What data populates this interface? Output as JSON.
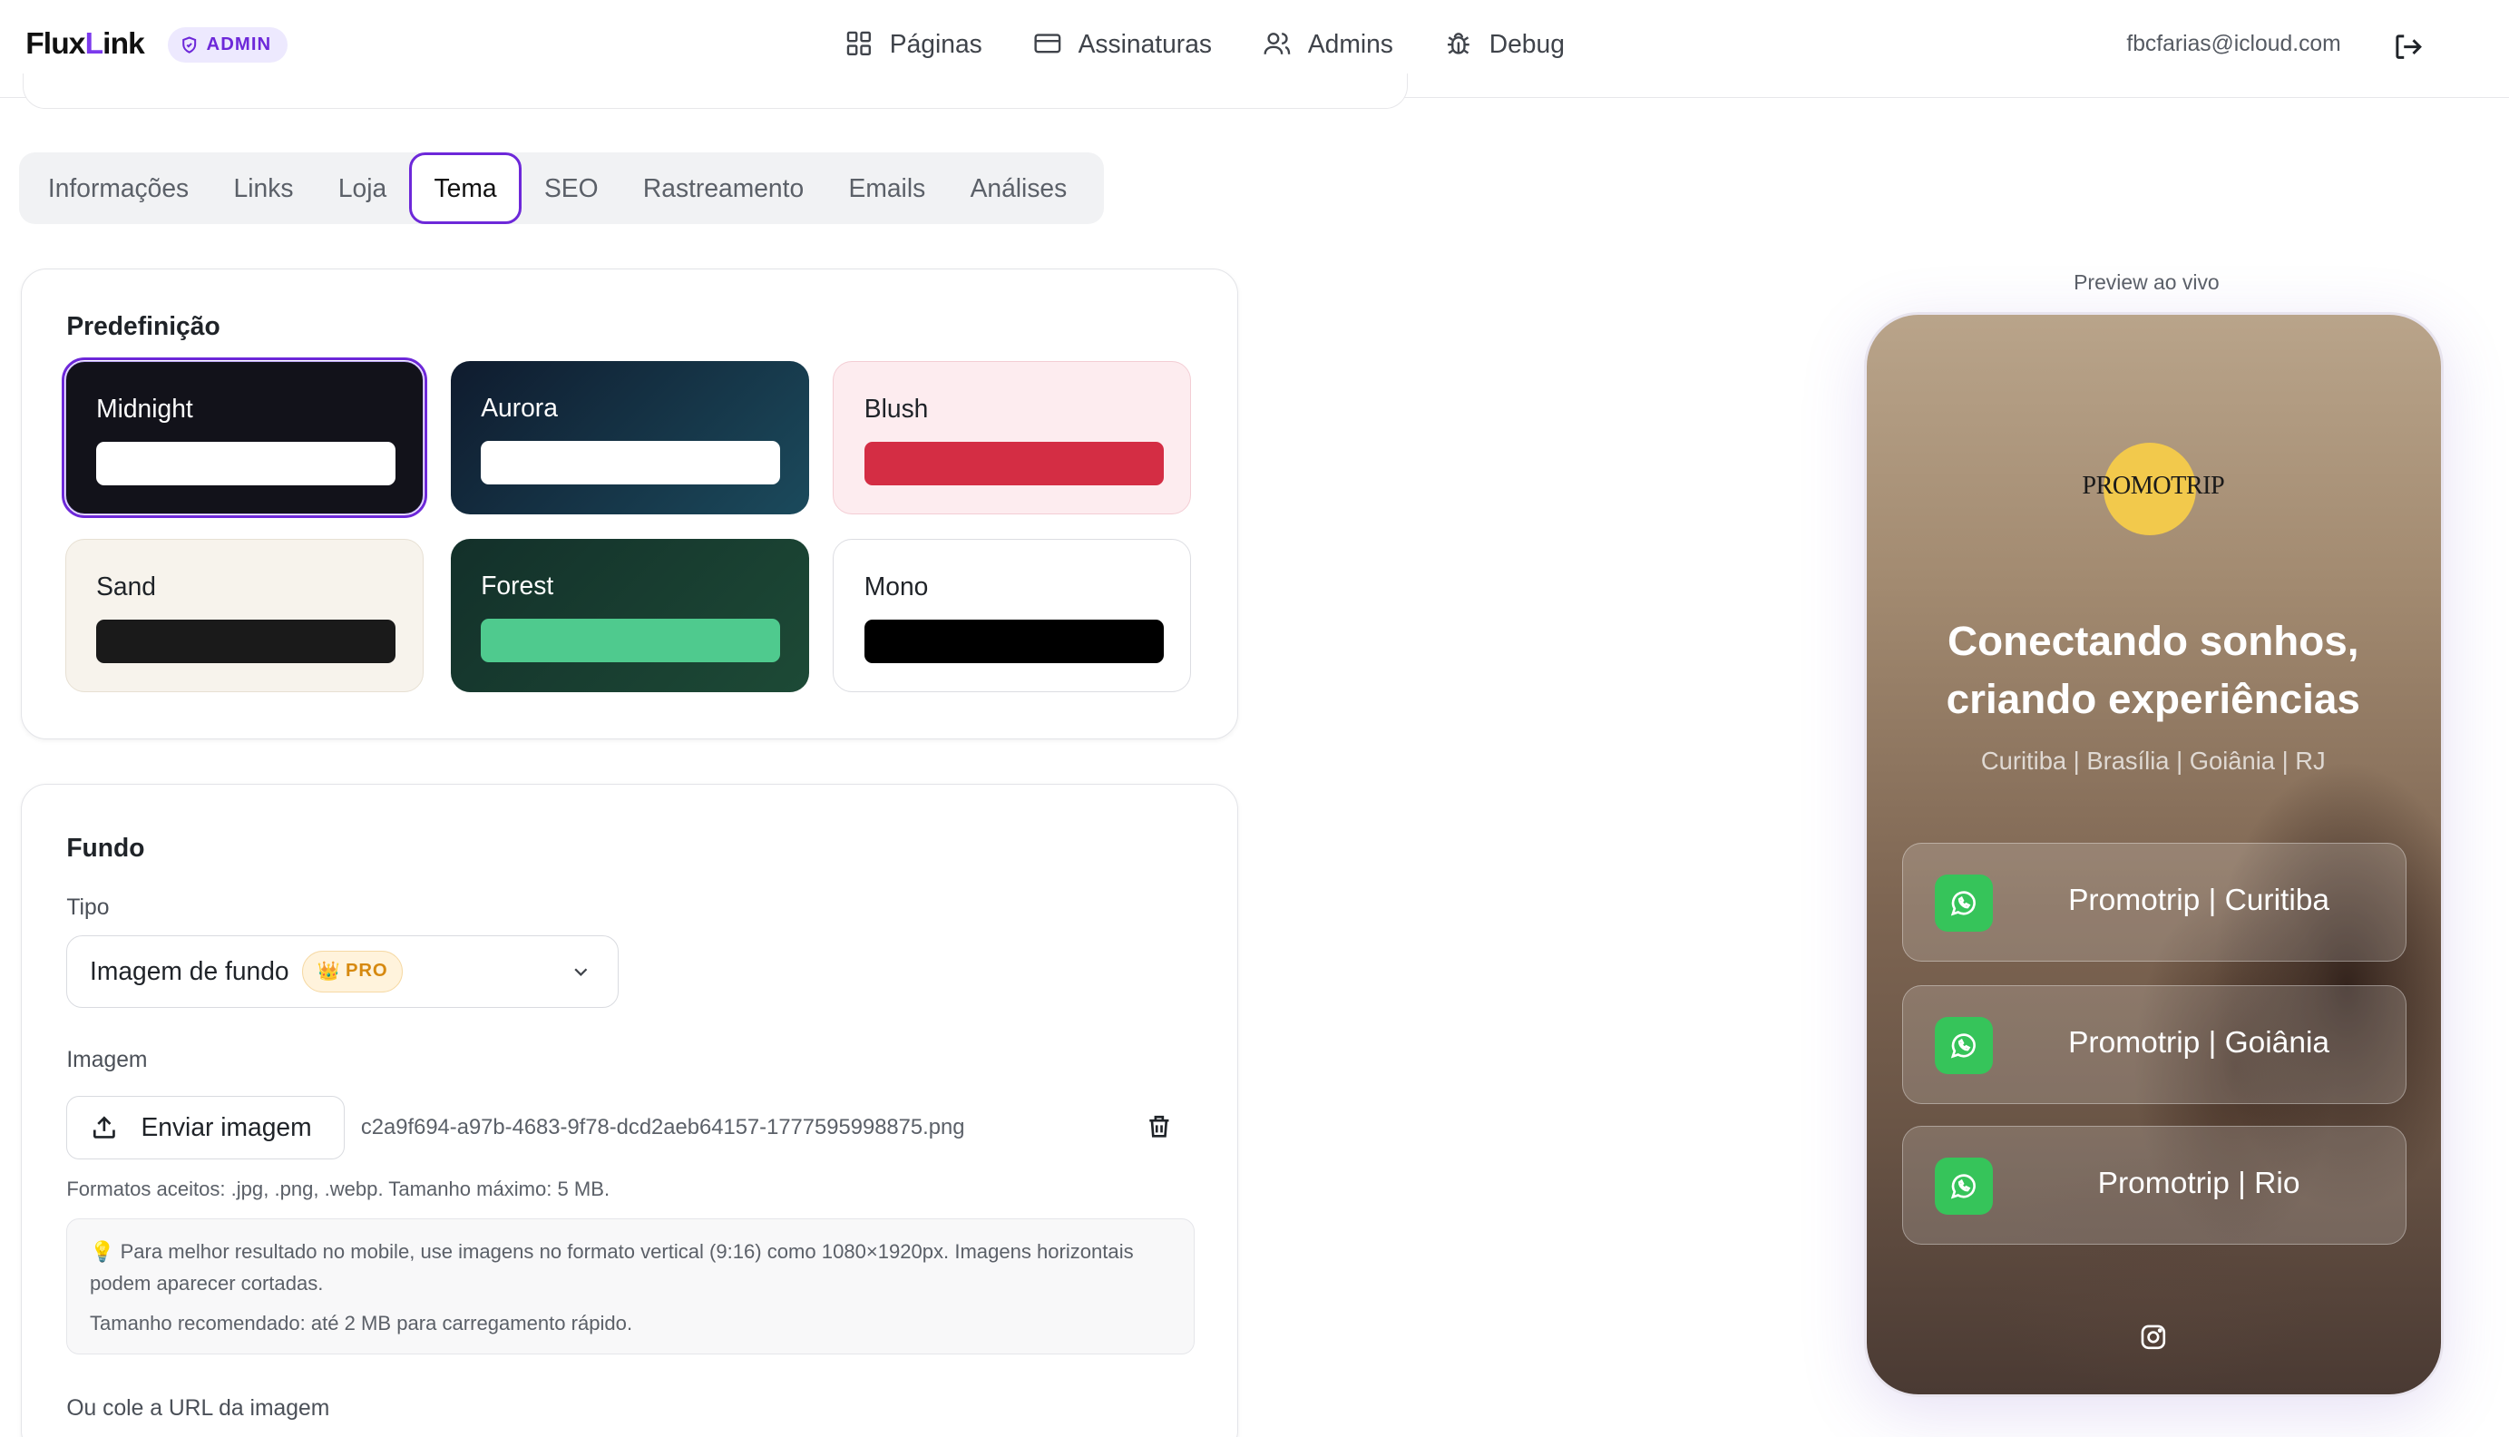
{
  "app": {
    "logo_prefix": "Flux",
    "logo_x": "L",
    "logo_suffix": "ink",
    "admin_badge": "ADMIN"
  },
  "nav": {
    "paginas": "Páginas",
    "assinaturas": "Assinaturas",
    "admins": "Admins",
    "debug": "Debug"
  },
  "user": {
    "email": "fbcfarias@icloud.com"
  },
  "tabs": [
    "Informações",
    "Links",
    "Loja",
    "Tema",
    "SEO",
    "Rastreamento",
    "Emails",
    "Análises"
  ],
  "active_tab": "Tema",
  "presets": {
    "title": "Predefinição",
    "items": [
      {
        "name": "Midnight",
        "bg": "#12121a",
        "bar": "#ffffff",
        "text": "#ffffff",
        "selected": true
      },
      {
        "name": "Aurora",
        "bg": "#16324a",
        "bar": "#ffffff",
        "text": "#ffffff",
        "selected": false
      },
      {
        "name": "Blush",
        "bg": "#fdecef",
        "bar": "#d42d44",
        "text": "#1f2328",
        "selected": false
      },
      {
        "name": "Sand",
        "bg": "#f7f3ec",
        "bar": "#1a1a1a",
        "text": "#1f2328",
        "selected": false
      },
      {
        "name": "Forest",
        "bg": "#17392c",
        "bar": "#4fca8e",
        "text": "#ffffff",
        "selected": false
      },
      {
        "name": "Mono",
        "bg": "#ffffff",
        "bar": "#000000",
        "text": "#1f2328",
        "selected": false
      }
    ]
  },
  "background": {
    "title": "Fundo",
    "type_label": "Tipo",
    "type_value": "Imagem de fundo",
    "pro_badge": "PRO",
    "image_label": "Imagem",
    "upload_label": "Enviar imagem",
    "filename": "c2a9f694-a97b-4683-9f78-dcd2aeb64157-1777595998875.png",
    "formats": "Formatos aceitos: .jpg, .png, .webp. Tamanho máximo: 5 MB.",
    "tip_line1": "💡 Para melhor resultado no mobile, use imagens no formato vertical (9:16) como 1080×1920px. Imagens horizontais podem aparecer cortadas.",
    "tip_line2": "Tamanho recomendado: até 2 MB para carregamento rápido.",
    "url_label": "Ou cole a URL da imagem"
  },
  "preview": {
    "label": "Preview ao vivo",
    "brand": "PROMOTRIP",
    "headline": "Conectando sonhos, criando experiências",
    "subline": "Curitiba | Brasília | Goiânia | RJ",
    "links": [
      "Promotrip | Curitiba",
      "Promotrip | Goiânia",
      "Promotrip | Rio"
    ]
  },
  "colors": {
    "accent": "#6d28d9",
    "whatsapp": "#36c45a",
    "brand_circle": "#f2c94c"
  }
}
